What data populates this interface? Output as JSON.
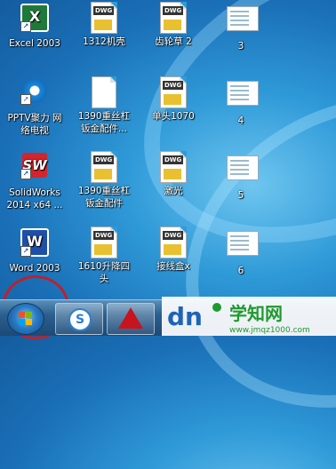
{
  "desktop": {
    "icons": [
      {
        "id": "excel",
        "label": "Excel 2003",
        "kind": "app-excel"
      },
      {
        "id": "1312",
        "label": "1312机壳",
        "kind": "dwg"
      },
      {
        "id": "gear",
        "label": "齿轮草 2",
        "kind": "dwg"
      },
      {
        "id": "shot3",
        "label": "3",
        "kind": "thumb"
      },
      {
        "id": "pptv",
        "label": "PPTV聚力 网\n络电视",
        "kind": "app-pptv"
      },
      {
        "id": "1390a",
        "label": "1390重丝杠\n钣金配件...",
        "kind": "page"
      },
      {
        "id": "dantou",
        "label": "单头1070",
        "kind": "dwg"
      },
      {
        "id": "shot4",
        "label": "4",
        "kind": "thumb"
      },
      {
        "id": "solidworks",
        "label": "SolidWorks\n2014 x64 ...",
        "kind": "app-sw"
      },
      {
        "id": "1390b",
        "label": "1390重丝杠\n钣金配件",
        "kind": "dwg"
      },
      {
        "id": "jiguang",
        "label": "激光",
        "kind": "dwg"
      },
      {
        "id": "shot5",
        "label": "5",
        "kind": "thumb"
      },
      {
        "id": "word",
        "label": "Word 2003",
        "kind": "app-word"
      },
      {
        "id": "1610",
        "label": "1610升降四\n头",
        "kind": "dwg"
      },
      {
        "id": "jiexian",
        "label": "接线盒x",
        "kind": "dwg"
      },
      {
        "id": "shot6",
        "label": "6",
        "kind": "thumb"
      }
    ]
  },
  "taskbar": {
    "start_label": "",
    "buttons": [
      "browser",
      "autocad"
    ]
  },
  "watermark": {
    "logo": "dn",
    "cn": "学知网",
    "url": "www.jmqz1000.com"
  },
  "colors": {
    "annotation": "#c0202a",
    "watermark_green": "#1e9a2e"
  }
}
